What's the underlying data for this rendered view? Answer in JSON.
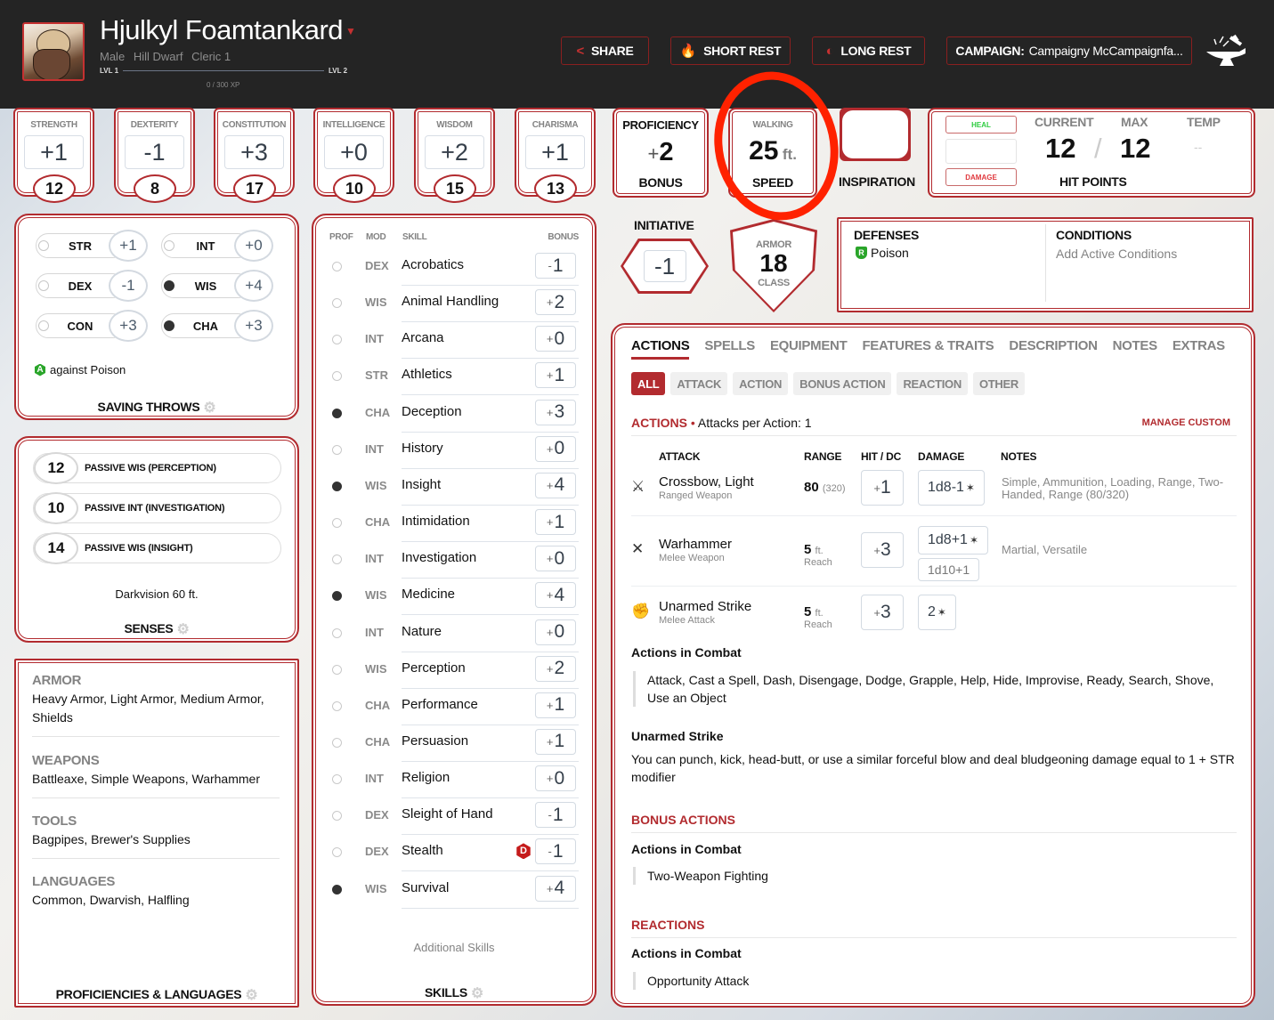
{
  "header": {
    "character_name": "Hjulkyl Foamtankard",
    "gender": "Male",
    "race": "Hill Dwarf",
    "class_level": "Cleric 1",
    "level_start_label": "LVL 1",
    "level_end_label": "LVL 2",
    "xp_text": "0 / 300 XP",
    "xp_progress": 0,
    "buttons": {
      "share": "SHARE",
      "short_rest": "SHORT REST",
      "long_rest": "LONG REST",
      "campaign_label": "CAMPAIGN:",
      "campaign_name": "Campaigny McCampaignfa..."
    }
  },
  "abilities": [
    {
      "name": "STRENGTH",
      "modifier": "+1",
      "score": "12"
    },
    {
      "name": "DEXTERITY",
      "modifier": "-1",
      "score": "8"
    },
    {
      "name": "CONSTITUTION",
      "modifier": "+3",
      "score": "17"
    },
    {
      "name": "INTELLIGENCE",
      "modifier": "+0",
      "score": "10"
    },
    {
      "name": "WISDOM",
      "modifier": "+2",
      "score": "15"
    },
    {
      "name": "CHARISMA",
      "modifier": "+1",
      "score": "13"
    }
  ],
  "proficiency": {
    "top_label": "PROFICIENCY",
    "value": "+2",
    "bottom_label": "BONUS"
  },
  "speed": {
    "top_label": "WALKING",
    "value": "25",
    "unit": "ft.",
    "bottom_label": "SPEED"
  },
  "inspiration": {
    "label": "INSPIRATION"
  },
  "hit_points": {
    "heal_label": "HEAL",
    "damage_label": "DAMAGE",
    "current_label": "CURRENT",
    "max_label": "MAX",
    "temp_label": "TEMP",
    "current": "12",
    "separator": "/",
    "max": "12",
    "temp": "--",
    "title": "HIT POINTS",
    "heal_color": "#2ecc40",
    "damage_color": "#e0393e"
  },
  "initiative": {
    "label": "INITIATIVE",
    "value": "-1"
  },
  "armor_class": {
    "top": "ARMOR",
    "value": "18",
    "bottom": "CLASS"
  },
  "defenses": {
    "title": "DEFENSES",
    "items": [
      {
        "badge": "R",
        "text": "Poison"
      }
    ]
  },
  "conditions": {
    "title": "CONDITIONS",
    "placeholder": "Add Active Conditions"
  },
  "saving_throws": {
    "title": "SAVING THROWS",
    "rows": [
      {
        "ability": "STR",
        "value": "+1",
        "proficient": false
      },
      {
        "ability": "INT",
        "value": "+0",
        "proficient": false
      },
      {
        "ability": "DEX",
        "value": "-1",
        "proficient": false
      },
      {
        "ability": "WIS",
        "value": "+4",
        "proficient": true
      },
      {
        "ability": "CON",
        "value": "+3",
        "proficient": false
      },
      {
        "ability": "CHA",
        "value": "+3",
        "proficient": true
      }
    ],
    "advantage_badge": "A",
    "advantage_note": "against Poison"
  },
  "senses": {
    "title": "SENSES",
    "rows": [
      {
        "value": "12",
        "label": "PASSIVE WIS (PERCEPTION)"
      },
      {
        "value": "10",
        "label": "PASSIVE INT (INVESTIGATION)"
      },
      {
        "value": "14",
        "label": "PASSIVE WIS (INSIGHT)"
      }
    ],
    "note": "Darkvision 60 ft."
  },
  "proficiencies": {
    "title": "PROFICIENCIES & LANGUAGES",
    "sections": [
      {
        "heading": "ARMOR",
        "text": "Heavy Armor, Light Armor, Medium Armor, Shields"
      },
      {
        "heading": "WEAPONS",
        "text": "Battleaxe, Simple Weapons, Warhammer"
      },
      {
        "heading": "TOOLS",
        "text": "Bagpipes, Brewer's Supplies"
      },
      {
        "heading": "LANGUAGES",
        "text": "Common, Dwarvish, Halfling"
      }
    ]
  },
  "skills": {
    "headers": {
      "prof": "PROF",
      "mod": "MOD",
      "skill": "SKILL",
      "bonus": "BONUS"
    },
    "rows": [
      {
        "mod": "DEX",
        "name": "Acrobatics",
        "sign": "-",
        "value": "1",
        "proficient": false
      },
      {
        "mod": "WIS",
        "name": "Animal Handling",
        "sign": "+",
        "value": "2",
        "proficient": false
      },
      {
        "mod": "INT",
        "name": "Arcana",
        "sign": "+",
        "value": "0",
        "proficient": false
      },
      {
        "mod": "STR",
        "name": "Athletics",
        "sign": "+",
        "value": "1",
        "proficient": false
      },
      {
        "mod": "CHA",
        "name": "Deception",
        "sign": "+",
        "value": "3",
        "proficient": true
      },
      {
        "mod": "INT",
        "name": "History",
        "sign": "+",
        "value": "0",
        "proficient": false
      },
      {
        "mod": "WIS",
        "name": "Insight",
        "sign": "+",
        "value": "4",
        "proficient": true
      },
      {
        "mod": "CHA",
        "name": "Intimidation",
        "sign": "+",
        "value": "1",
        "proficient": false
      },
      {
        "mod": "INT",
        "name": "Investigation",
        "sign": "+",
        "value": "0",
        "proficient": false
      },
      {
        "mod": "WIS",
        "name": "Medicine",
        "sign": "+",
        "value": "4",
        "proficient": true
      },
      {
        "mod": "INT",
        "name": "Nature",
        "sign": "+",
        "value": "0",
        "proficient": false
      },
      {
        "mod": "WIS",
        "name": "Perception",
        "sign": "+",
        "value": "2",
        "proficient": false
      },
      {
        "mod": "CHA",
        "name": "Performance",
        "sign": "+",
        "value": "1",
        "proficient": false
      },
      {
        "mod": "CHA",
        "name": "Persuasion",
        "sign": "+",
        "value": "1",
        "proficient": false
      },
      {
        "mod": "INT",
        "name": "Religion",
        "sign": "+",
        "value": "0",
        "proficient": false
      },
      {
        "mod": "DEX",
        "name": "Sleight of Hand",
        "sign": "-",
        "value": "1",
        "proficient": false
      },
      {
        "mod": "DEX",
        "name": "Stealth",
        "sign": "-",
        "value": "1",
        "proficient": false,
        "disadvantage": "D"
      },
      {
        "mod": "WIS",
        "name": "Survival",
        "sign": "+",
        "value": "4",
        "proficient": true
      }
    ],
    "additional": "Additional Skills",
    "title": "SKILLS"
  },
  "main_tabs": [
    "ACTIONS",
    "SPELLS",
    "EQUIPMENT",
    "FEATURES & TRAITS",
    "DESCRIPTION",
    "NOTES",
    "EXTRAS"
  ],
  "filters": [
    "ALL",
    "ATTACK",
    "ACTION",
    "BONUS ACTION",
    "REACTION",
    "OTHER"
  ],
  "actions": {
    "heading": "ACTIONS",
    "bullet": "•",
    "attacks_per_action": "Attacks per Action: 1",
    "manage_custom": "MANAGE CUSTOM",
    "columns": {
      "attack": "ATTACK",
      "range": "RANGE",
      "hit": "HIT / DC",
      "damage": "DAMAGE",
      "notes": "NOTES"
    },
    "attacks": [
      {
        "name": "Crossbow, Light",
        "type": "Ranged Weapon",
        "range": "80",
        "range_long": "(320)",
        "range_sub": "",
        "hit_sign": "+",
        "hit": "1",
        "damage": "1d8-1",
        "damage_alt": "",
        "notes": "Simple, Ammunition, Loading, Range, Two-Handed, Range (80/320)"
      },
      {
        "name": "Warhammer",
        "type": "Melee Weapon",
        "range": "5",
        "range_long": "ft.",
        "range_sub": "Reach",
        "hit_sign": "+",
        "hit": "3",
        "damage": "1d8+1",
        "damage_alt": "1d10+1",
        "notes": "Martial, Versatile"
      },
      {
        "name": "Unarmed Strike",
        "type": "Melee Attack",
        "range": "5",
        "range_long": "ft.",
        "range_sub": "Reach",
        "hit_sign": "+",
        "hit": "3",
        "damage": "2",
        "damage_alt": "",
        "notes": ""
      }
    ],
    "combat_title": "Actions in Combat",
    "combat_list": "Attack, Cast a Spell, Dash, Disengage, Dodge, Grapple, Help, Hide, Improvise, Ready, Search, Shove, Use an Object",
    "unarmed_title": "Unarmed Strike",
    "unarmed_text": "You can punch, kick, head-butt, or use a similar forceful blow and deal bludgeoning damage equal to 1 + STR modifier"
  },
  "bonus_actions": {
    "heading": "BONUS ACTIONS",
    "sub": "Actions in Combat",
    "item": "Two-Weapon Fighting"
  },
  "reactions": {
    "heading": "REACTIONS",
    "sub": "Actions in Combat",
    "item": "Opportunity Attack"
  },
  "colors": {
    "accent": "#b22b2f",
    "topbar": "#242424",
    "annotation": "#ff2200"
  }
}
